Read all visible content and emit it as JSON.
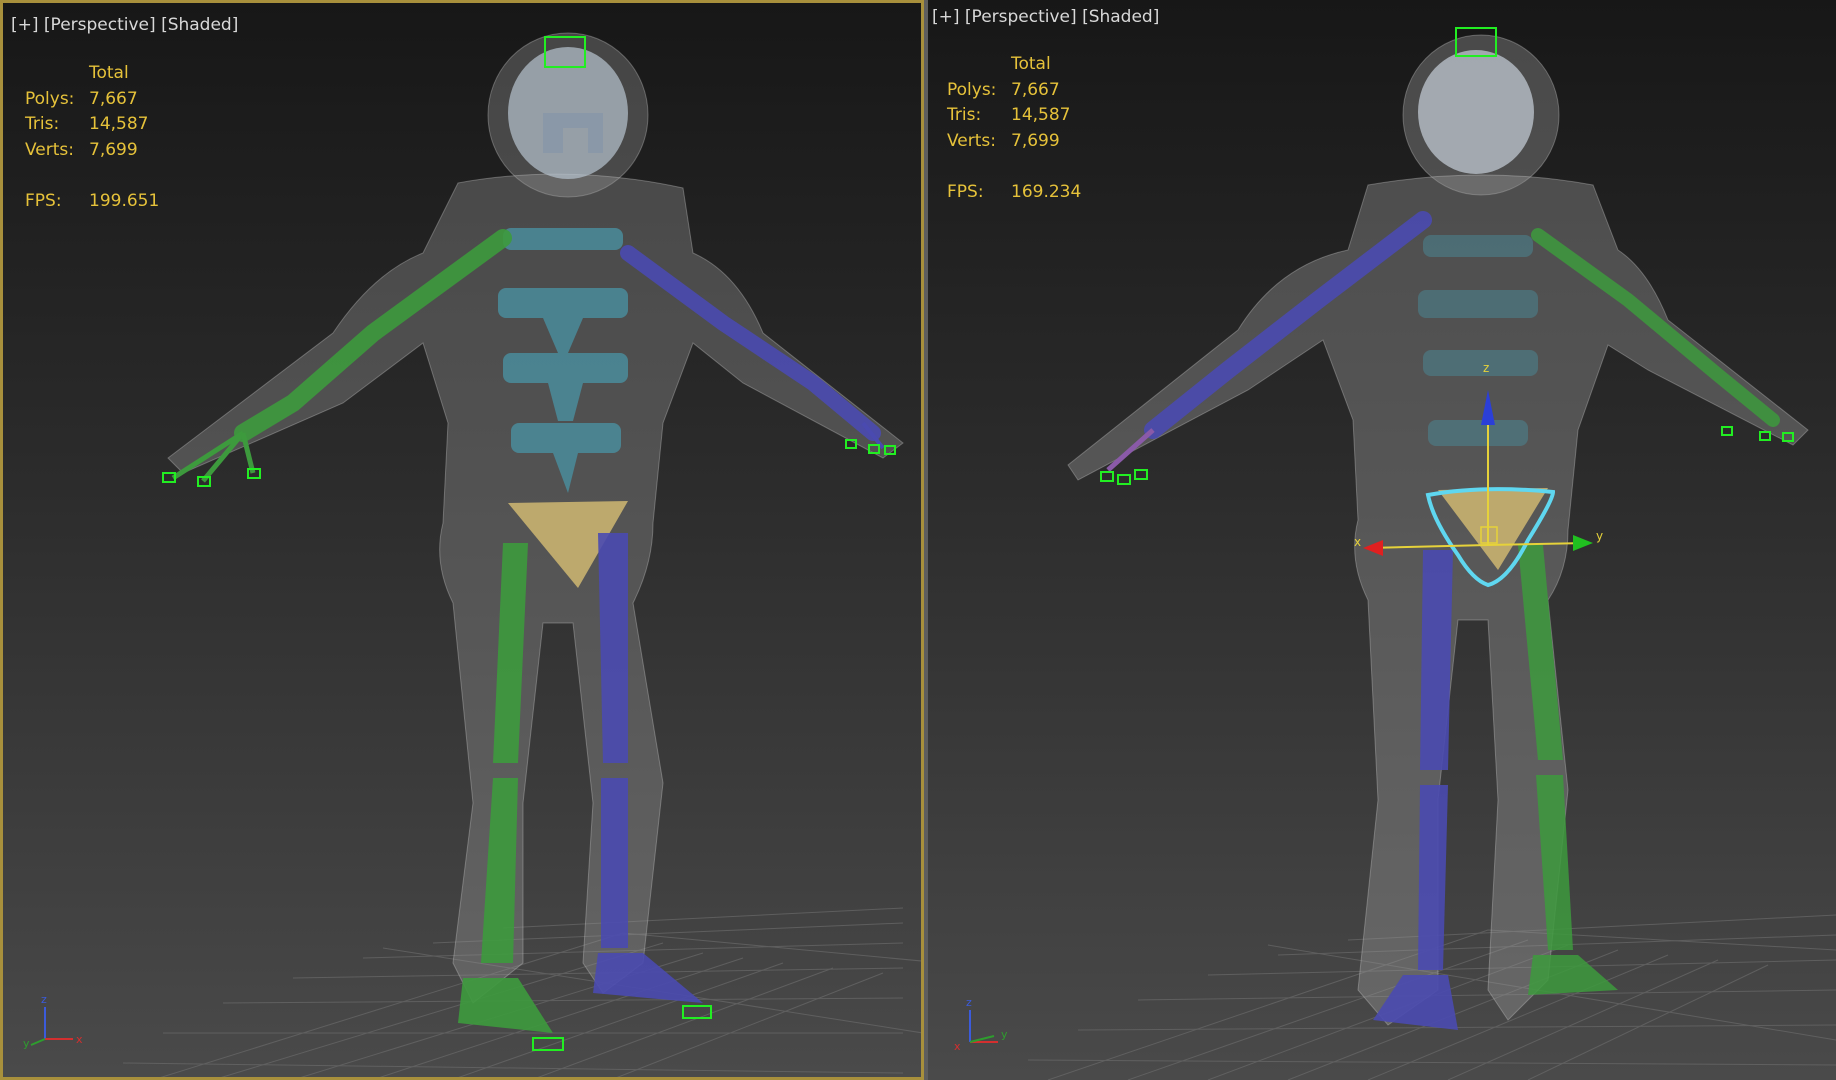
{
  "viewports": [
    {
      "label": {
        "plus": "[+]",
        "view": "[Perspective]",
        "shading": "[Shaded]"
      },
      "stats": {
        "header": "Total",
        "polys_label": "Polys:",
        "polys": "7,667",
        "tris_label": "Tris:",
        "tris": "14,587",
        "verts_label": "Verts:",
        "verts": "7,699",
        "fps_label": "FPS:",
        "fps": "199.651"
      },
      "active": true
    },
    {
      "label": {
        "plus": "[+]",
        "view": "[Perspective]",
        "shading": "[Shaded]"
      },
      "stats": {
        "header": "Total",
        "polys_label": "Polys:",
        "polys": "7,667",
        "tris_label": "Tris:",
        "tris": "14,587",
        "verts_label": "Verts:",
        "verts": "7,699",
        "fps_label": "FPS:",
        "fps": "169.234"
      },
      "active": false
    }
  ],
  "gizmo": {
    "x": "x",
    "y": "y",
    "z": "z"
  },
  "colors": {
    "active_border": "#a8903c",
    "stats_text": "#e6c23a",
    "bone_green": "#3d9a3d",
    "bone_blue": "#4a4ab0",
    "spine_cyan": "#4a90a0",
    "pelvis": "#c9b270",
    "selection": "#5fd7f0"
  }
}
